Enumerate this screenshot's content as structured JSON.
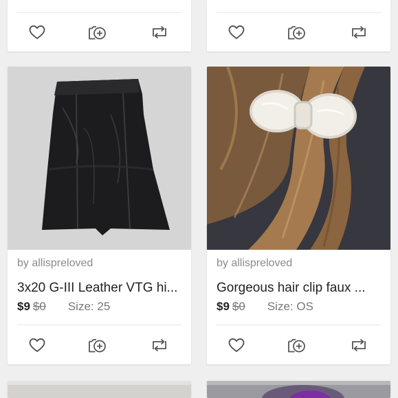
{
  "listings": [
    {
      "seller": "by allispreloved",
      "title": "3x20 G-III Leather  VTG hi...",
      "price": "$9",
      "original_price": "$0",
      "size": "Size: 25",
      "image": "black-leather-skirt"
    },
    {
      "seller": "by allispreloved",
      "title": "Gorgeous hair  clip faux  ...",
      "price": "$9",
      "original_price": "$0",
      "size": "Size: OS",
      "image": "pearl-bow-hair-clip"
    }
  ],
  "actions": {
    "like_icon": "heart-icon",
    "bundle_icon": "add-to-bundle-icon",
    "share_icon": "share-icon"
  },
  "colors": {
    "background": "#efefef",
    "card": "#ffffff",
    "icon": "#555555",
    "text": "#222222",
    "muted": "#8a8a8a"
  }
}
